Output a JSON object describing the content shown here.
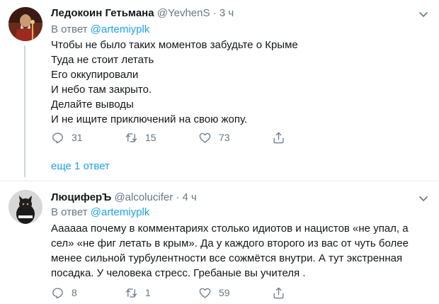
{
  "tweets": [
    {
      "author_name": "Ледокоин Гетьмана",
      "handle": "@YevhenS",
      "separator": "·",
      "time": "3 ч",
      "reply_prefix": "В ответ",
      "reply_to": "@artemiyplk",
      "lines": [
        "Чтобы не было таких моментов забудьте о Крыме",
        "Туда не стоит летать",
        "Его оккупировали",
        "И небо там закрыто.",
        "Делайте выводы",
        "И не ищите приключений на свою жопу."
      ],
      "replies": "31",
      "retweets": "15",
      "likes": "73",
      "show_replies": "еще 1 ответ"
    },
    {
      "author_name": "ЛюциферЪ",
      "handle": "@alcolucifer",
      "separator": "·",
      "time": "4 ч",
      "reply_prefix": "В ответ",
      "reply_to": "@artemiyplk",
      "lines": [
        "Аааааа почему в комментариях столько идиотов и нацистов «не упал, а",
        "сел» «не фиг летать в крым». Да у каждого второго из вас от чуть более",
        "менее сильной турбулентности все сожмётся внутри. А тут экстренная",
        "посадка. У человека стресс. Гребаные вы учителя ."
      ],
      "replies": "8",
      "retweets": "1",
      "likes": "59"
    }
  ],
  "icons": {
    "reply": "reply-icon",
    "retweet": "retweet-icon",
    "like": "heart-icon",
    "share": "share-icon",
    "caret": "chevron-down-icon"
  },
  "colors": {
    "accent": "#1da1f2",
    "secondary_text": "#657786",
    "thread_line": "#ccd6dd",
    "divider": "#e6ecf0"
  }
}
